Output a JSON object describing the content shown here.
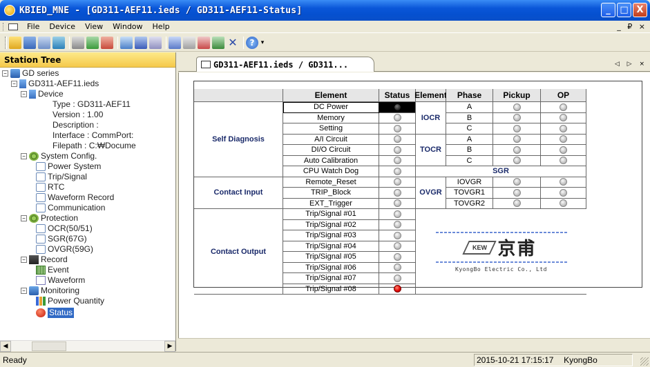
{
  "window": {
    "title": "KBIED_MNE - [GD311-AEF11.ieds / GD311-AEF11-Status]",
    "buttons": [
      "_",
      "□",
      "X"
    ]
  },
  "menu": {
    "items": [
      "File",
      "Device",
      "View",
      "Window",
      "Help"
    ],
    "mdi_controls": "_ ₽ ×"
  },
  "toolbar": {
    "buttons": [
      "open-folder",
      "save",
      "print-setup",
      "network",
      "print",
      "connect",
      "disconnect",
      "device-config",
      "monitor",
      "window",
      "cascade",
      "tile",
      "close-all",
      "layout",
      "about",
      "help"
    ]
  },
  "station_tree": {
    "header": "Station Tree",
    "nodes": [
      {
        "label": "GD series"
      },
      {
        "label": "GD311-AEF11.ieds"
      },
      {
        "label": "Device"
      },
      {
        "label": "Type : GD311-AEF11"
      },
      {
        "label": "Version : 1.00"
      },
      {
        "label": "Description :"
      },
      {
        "label": "Interface : CommPort:"
      },
      {
        "label": "Filepath : C:₩Docume"
      },
      {
        "label": "System Config."
      },
      {
        "label": "Power System"
      },
      {
        "label": "Trip/Signal"
      },
      {
        "label": "RTC"
      },
      {
        "label": "Waveform Record"
      },
      {
        "label": "Communication"
      },
      {
        "label": "Protection"
      },
      {
        "label": "OCR(50/51)"
      },
      {
        "label": "SGR(67G)"
      },
      {
        "label": "OVGR(59G)"
      },
      {
        "label": "Record"
      },
      {
        "label": "Event"
      },
      {
        "label": "Waveform"
      },
      {
        "label": "Monitoring"
      },
      {
        "label": "Power Quantity"
      },
      {
        "label": "Status"
      }
    ]
  },
  "tab": {
    "label": "GD311-AEF11.ieds / GD311...",
    "arrows": "◁ ▷ ×"
  },
  "status_table": {
    "headers": {
      "element": "Element",
      "status": "Status",
      "element2": "Element",
      "phase": "Phase",
      "pickup": "Pickup",
      "op": "OP"
    },
    "groups": {
      "self_diagnosis": "Self Diagnosis",
      "contact_input": "Contact Input",
      "contact_output": "Contact Output"
    },
    "rows": [
      {
        "element": "DC Power",
        "status": "dark"
      },
      {
        "element": "Memory",
        "status": "off"
      },
      {
        "element": "Setting",
        "status": "off"
      },
      {
        "element": "A/I Circuit",
        "status": "off"
      },
      {
        "element": "DI/O Circuit",
        "status": "off"
      },
      {
        "element": "Auto Calibration",
        "status": "off"
      },
      {
        "element": "CPU Watch Dog",
        "status": "off"
      },
      {
        "element": "Remote_Reset",
        "status": "off"
      },
      {
        "element": "TRIP_Block",
        "status": "off"
      },
      {
        "element": "EXT_Trigger",
        "status": "off"
      },
      {
        "element": "Trip/Signal #01",
        "status": "off"
      },
      {
        "element": "Trip/Signal #02",
        "status": "off"
      },
      {
        "element": "Trip/Signal #03",
        "status": "off"
      },
      {
        "element": "Trip/Signal #04",
        "status": "off"
      },
      {
        "element": "Trip/Signal #05",
        "status": "off"
      },
      {
        "element": "Trip/Signal #06",
        "status": "off"
      },
      {
        "element": "Trip/Signal #07",
        "status": "off"
      },
      {
        "element": "Trip/Signal #08",
        "status": "on"
      }
    ],
    "protection": {
      "iocr": "IOCR",
      "tocr": "TOCR",
      "sgr": "SGR",
      "ovgr": "OVGR",
      "iocr_phases": [
        "A",
        "B",
        "C"
      ],
      "tocr_phases": [
        "A",
        "B",
        "C"
      ],
      "ovgr_phases": [
        "IOVGR",
        "TOVGR1",
        "TOVGR2"
      ]
    },
    "logo": {
      "mark": "KEW",
      "kanji": "京甫",
      "company": "KyongBo Electric Co., Ltd"
    }
  },
  "statusbar": {
    "ready": "Ready",
    "datetime": "2015-10-21 17:15:17",
    "user": "KyongBo"
  },
  "colors": {
    "title_blue": "#0a56d8",
    "selected": "#316ac5",
    "led_on": "#e00000",
    "group_text": "#1a2a6a"
  }
}
